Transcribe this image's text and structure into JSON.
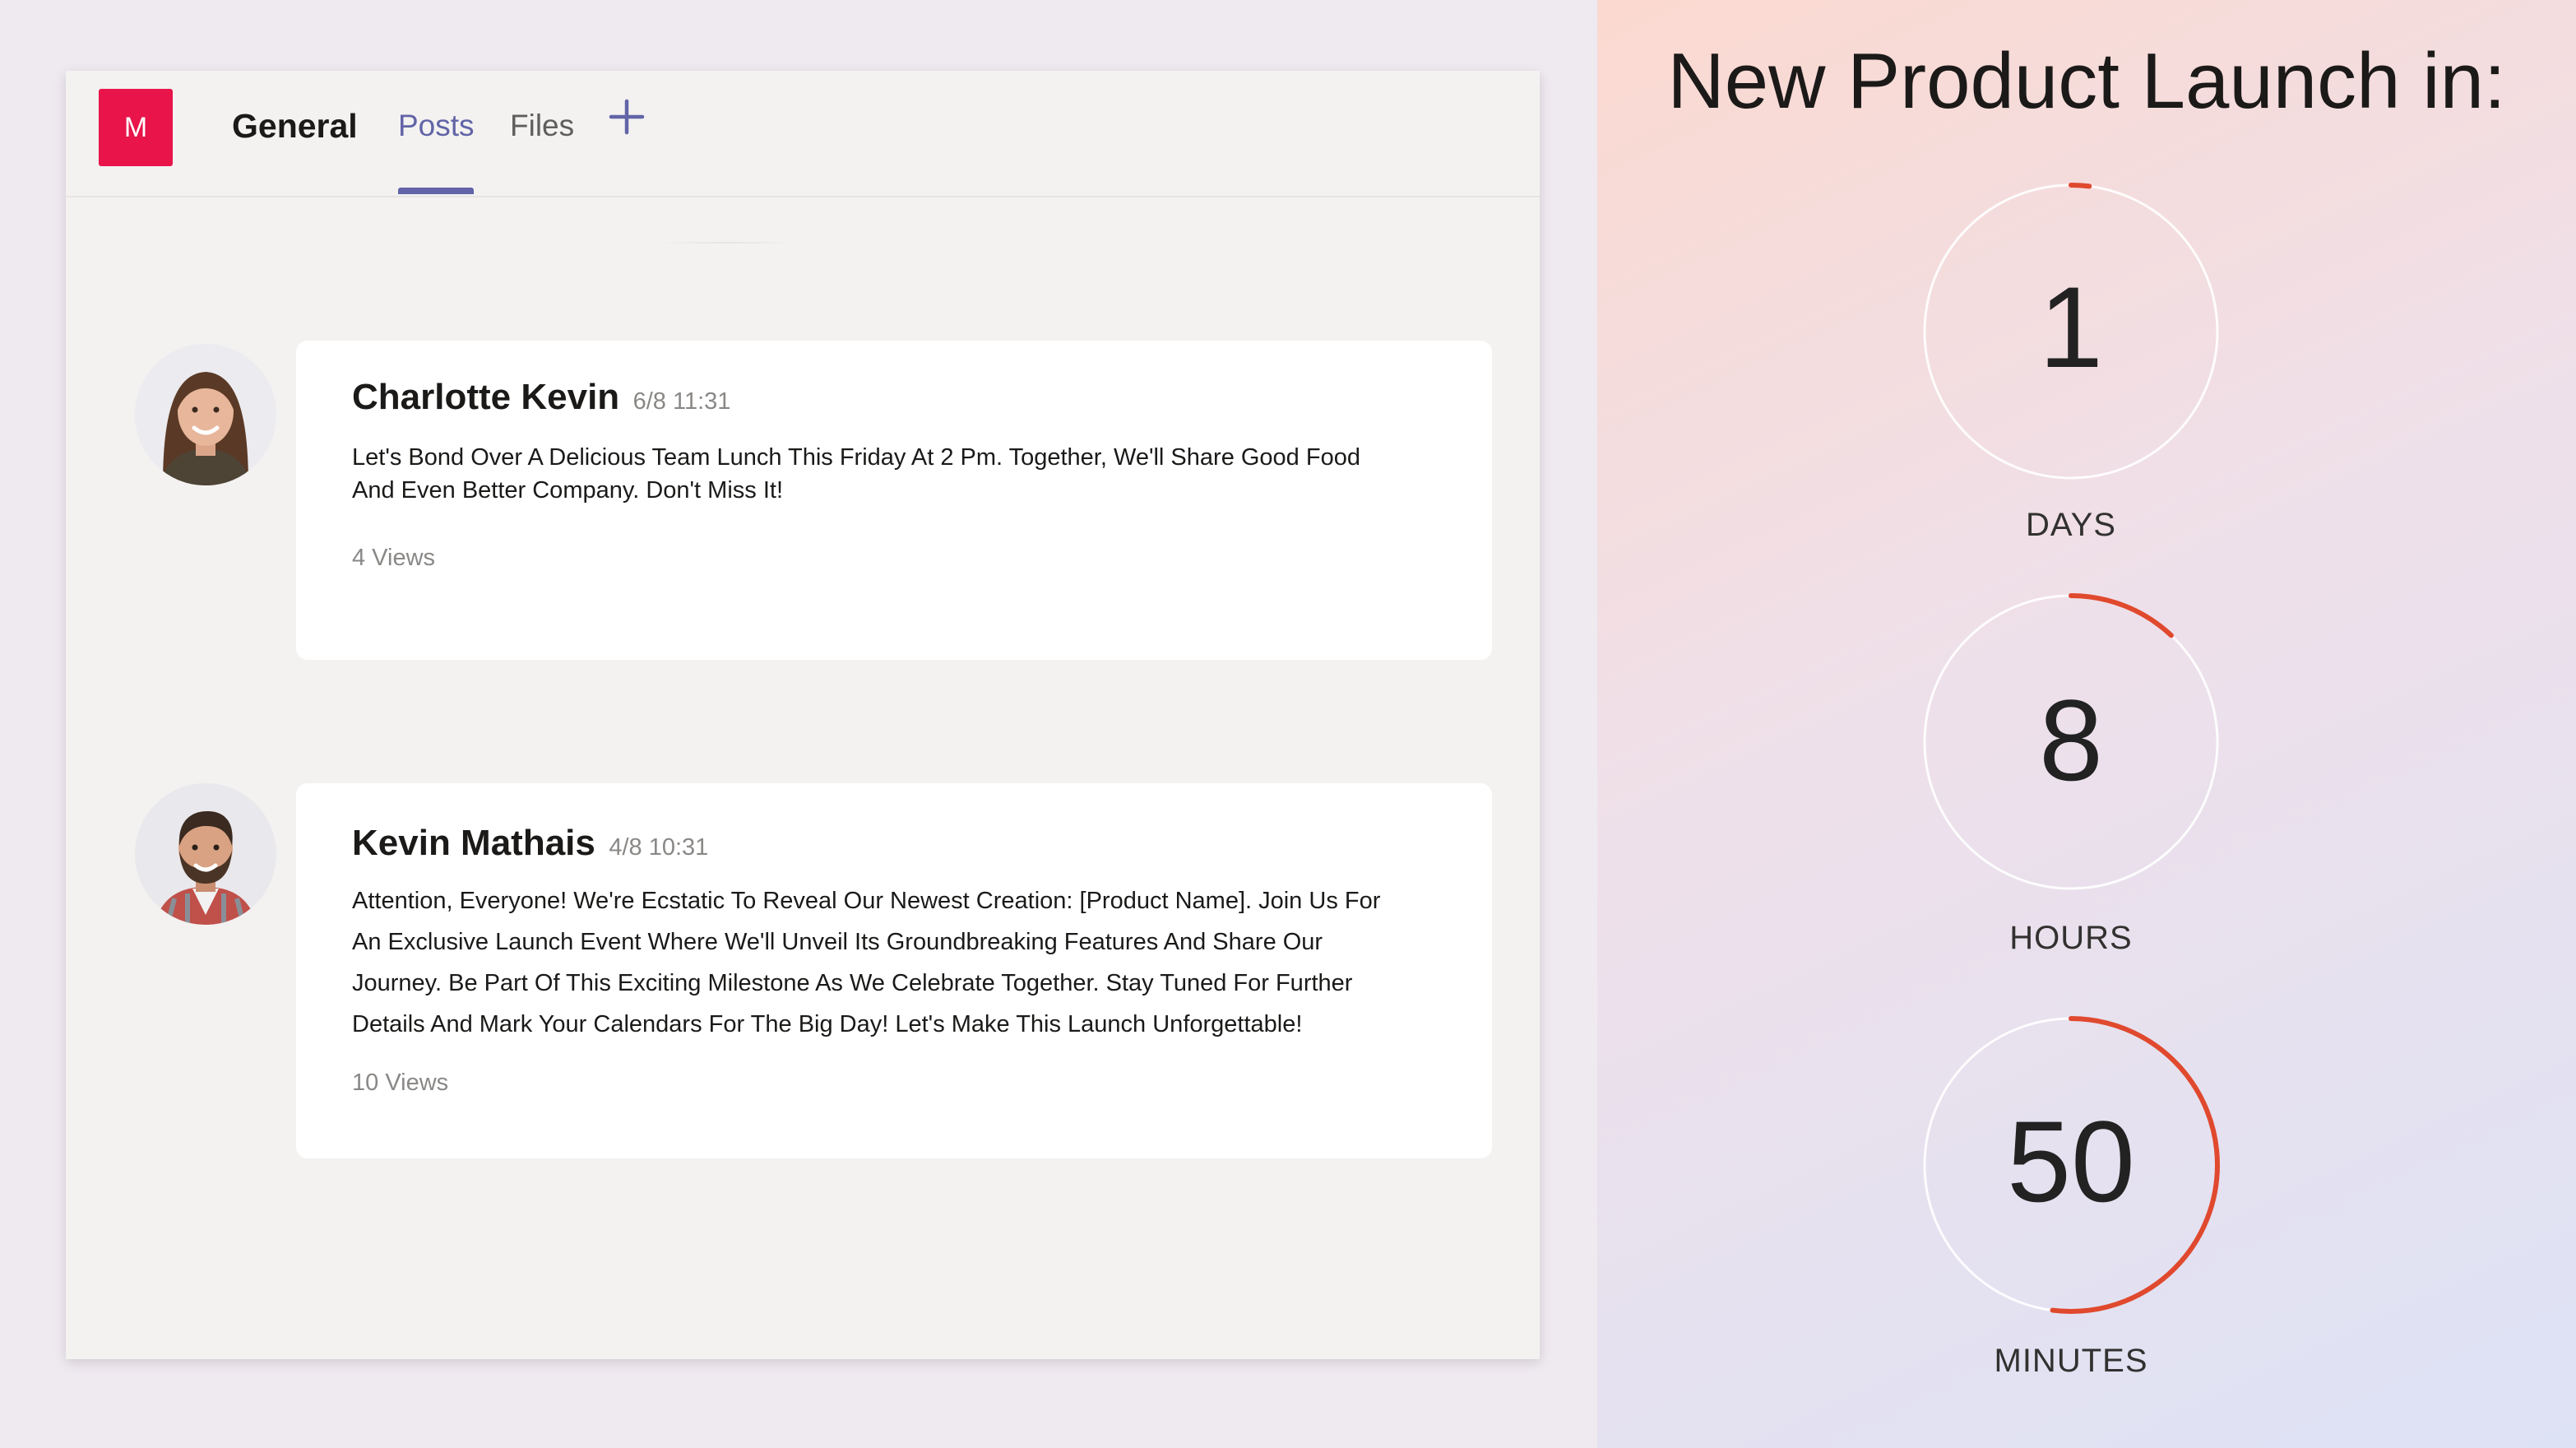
{
  "channel": {
    "team_initial": "M",
    "name": "General",
    "tabs": [
      "Posts",
      "Files"
    ],
    "active_tab": "Posts",
    "add_tab_icon": "plus-icon"
  },
  "posts": [
    {
      "author": "Charlotte Kevin",
      "time": "6/8 11:31",
      "body_lines": [
        "Let's Bond Over A Delicious Team Lunch This Friday At 2 Pm. Together, We'll Share Good Food",
        "And Even Better Company. Don't Miss It!"
      ],
      "views": "4 Views"
    },
    {
      "author": "Kevin Mathais",
      "time": "4/8 10:31",
      "body_lines": [
        "Attention, Everyone! We're Ecstatic To Reveal Our Newest Creation: [Product Name]. Join Us For",
        "An Exclusive Launch Event Where We'll Unveil Its Groundbreaking Features And Share Our",
        "Journey. Be Part Of This Exciting Milestone As We Celebrate Together. Stay Tuned For Further",
        "Details And Mark Your Calendars For The Big Day! Let's Make This Launch Unforgettable!"
      ],
      "views": "10 Views"
    }
  ],
  "countdown": {
    "title": "New Product Launch in:",
    "units": [
      {
        "value": "1",
        "label": "DAYS",
        "progress": 0.02
      },
      {
        "value": "8",
        "label": "HOURS",
        "progress": 0.12
      },
      {
        "value": "50",
        "label": "MINUTES",
        "progress": 0.52
      }
    ],
    "accent_color": "#e0492e"
  },
  "colors": {
    "team_avatar": "#e8144a",
    "active_tab": "#6264a7"
  }
}
